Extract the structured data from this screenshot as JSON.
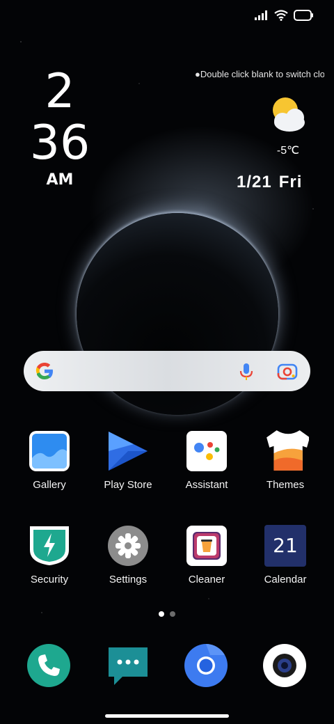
{
  "clock": {
    "hour": "2",
    "minute": "36",
    "ampm": "AM"
  },
  "hint_text": "●Double click blank to switch clock",
  "weather": {
    "temperature": "-5℃",
    "icon": "partly-cloudy-icon"
  },
  "date": {
    "day": "1/21",
    "weekday": "Fri"
  },
  "search": {
    "google_icon": "google-icon",
    "mic_icon": "mic-icon",
    "lens_icon": "lens-icon"
  },
  "apps_row1": [
    {
      "label": "Gallery",
      "icon": "gallery-icon"
    },
    {
      "label": "Play Store",
      "icon": "play-store-icon"
    },
    {
      "label": "Assistant",
      "icon": "assistant-icon"
    },
    {
      "label": "Themes",
      "icon": "themes-icon"
    }
  ],
  "apps_row2": [
    {
      "label": "Security",
      "icon": "security-icon"
    },
    {
      "label": "Settings",
      "icon": "settings-icon"
    },
    {
      "label": "Cleaner",
      "icon": "cleaner-icon"
    },
    {
      "label": "Calendar",
      "icon": "calendar-icon",
      "day": "21"
    }
  ],
  "page_indicator": {
    "current": 1,
    "total": 2
  },
  "dock": [
    {
      "icon": "phone-icon"
    },
    {
      "icon": "messages-icon"
    },
    {
      "icon": "chrome-icon"
    },
    {
      "icon": "camera-icon"
    }
  ],
  "colors": {
    "accent_green": "#1ea88f",
    "messages_teal": "#1c8f96",
    "chrome_blue": "#3d7bf0"
  }
}
